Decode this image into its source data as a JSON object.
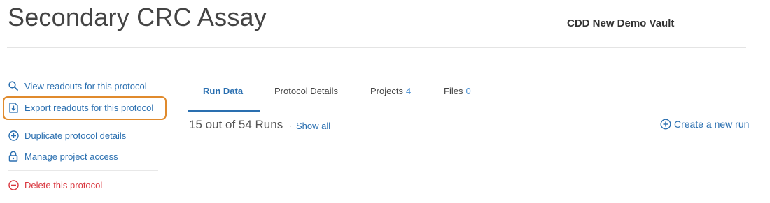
{
  "header": {
    "title": "Secondary CRC Assay",
    "vault_name": "CDD New Demo Vault"
  },
  "sidebar": {
    "actions": [
      {
        "label": "View readouts for this protocol",
        "icon": "search-icon"
      },
      {
        "label": "Export readouts for this protocol",
        "icon": "export-icon",
        "highlighted": true
      },
      {
        "label": "Duplicate protocol details",
        "icon": "plus-circle-icon"
      },
      {
        "label": "Manage project access",
        "icon": "lock-icon"
      },
      {
        "label": "Delete this protocol",
        "icon": "minus-circle-icon",
        "danger": true
      }
    ]
  },
  "tabs": [
    {
      "label": "Run Data",
      "count": "",
      "active": true
    },
    {
      "label": "Protocol Details",
      "count": ""
    },
    {
      "label": "Projects",
      "count": "4"
    },
    {
      "label": "Files",
      "count": "0"
    }
  ],
  "runs": {
    "summary": "15 out of 54 Runs",
    "separator": "·",
    "show_all_label": "Show all",
    "create_label": "Create a new run"
  },
  "colors": {
    "link": "#2a6fb0",
    "danger": "#d9363e",
    "highlight": "#e08a2c"
  }
}
